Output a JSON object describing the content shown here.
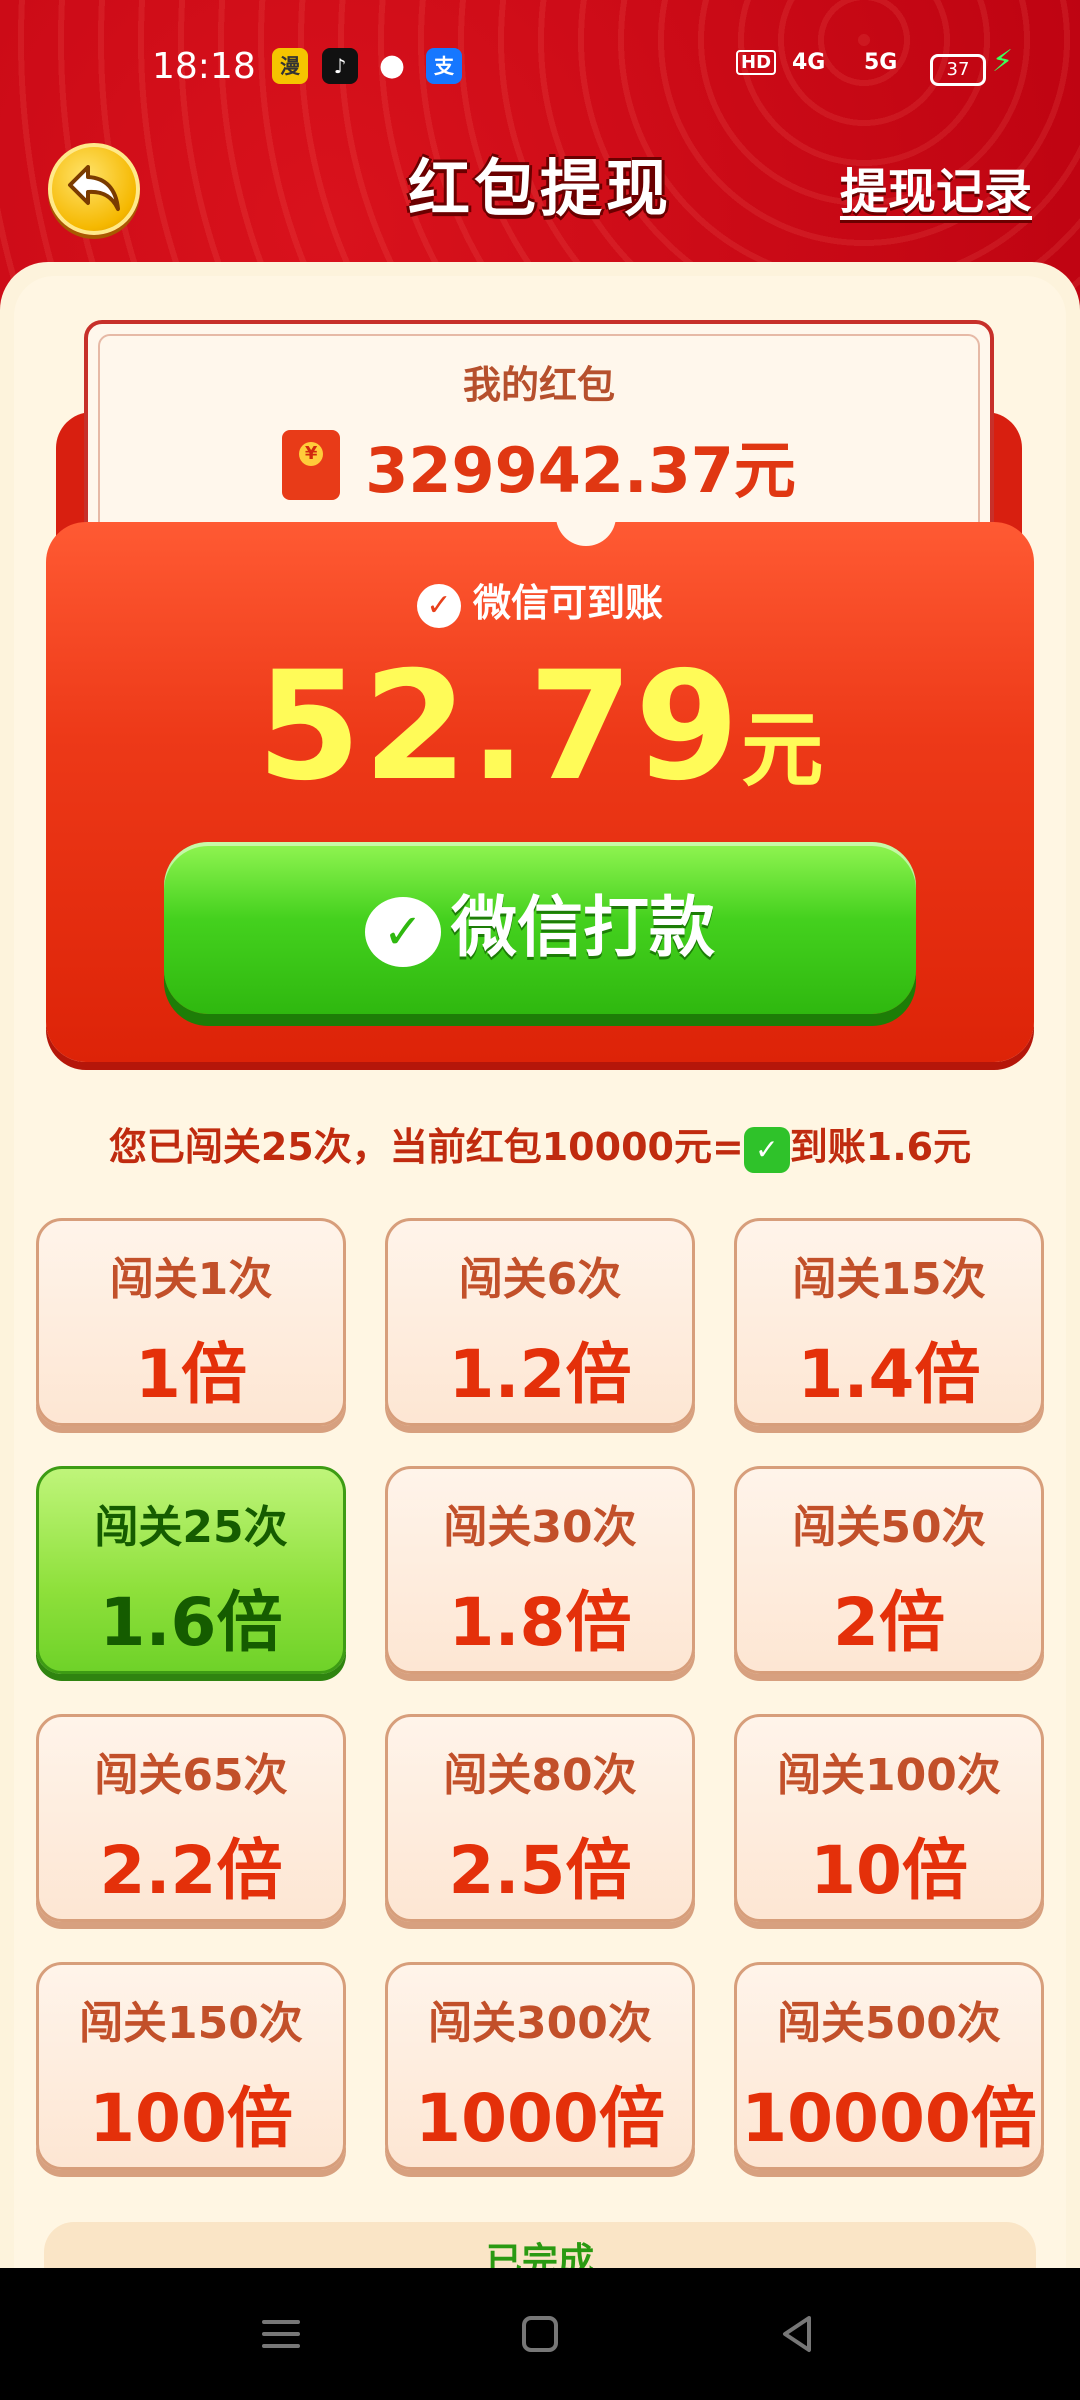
{
  "status": {
    "time": "18:18",
    "battery": "37",
    "network_1": "HD",
    "network_2": "4G",
    "network_3": "5G"
  },
  "header": {
    "title": "红包提现",
    "records": "提现记录"
  },
  "my_redpacket": {
    "label": "我的红包",
    "amount": "329942.37元"
  },
  "withdraw": {
    "wx_line": "微信可到账",
    "amount": "52.79",
    "unit": "元",
    "button": "微信打款"
  },
  "info": {
    "prefix": "您已闯关25次，当前红包10000元=",
    "suffix": "到账1.6元"
  },
  "levels": [
    {
      "lv": "闯关1次",
      "mul": "1倍"
    },
    {
      "lv": "闯关6次",
      "mul": "1.2倍"
    },
    {
      "lv": "闯关15次",
      "mul": "1.4倍"
    },
    {
      "lv": "闯关25次",
      "mul": "1.6倍"
    },
    {
      "lv": "闯关30次",
      "mul": "1.8倍"
    },
    {
      "lv": "闯关50次",
      "mul": "2倍"
    },
    {
      "lv": "闯关65次",
      "mul": "2.2倍"
    },
    {
      "lv": "闯关80次",
      "mul": "2.5倍"
    },
    {
      "lv": "闯关100次",
      "mul": "10倍"
    },
    {
      "lv": "闯关150次",
      "mul": "100倍"
    },
    {
      "lv": "闯关300次",
      "mul": "1000倍"
    },
    {
      "lv": "闯关500次",
      "mul": "10000倍"
    }
  ],
  "completed": "已完成"
}
